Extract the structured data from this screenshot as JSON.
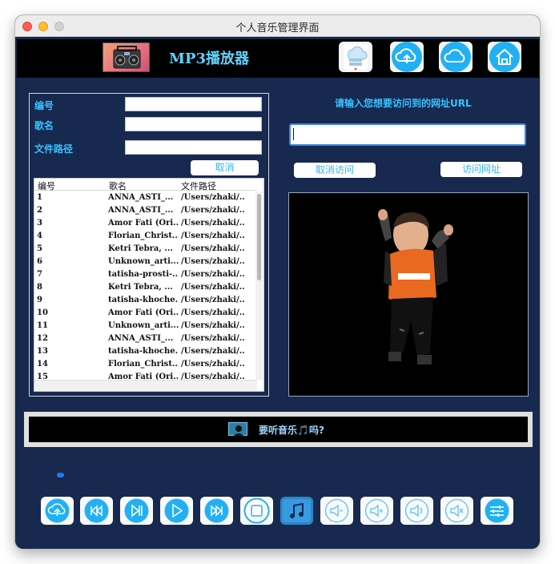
{
  "window": {
    "title": "个人音乐管理界面"
  },
  "header": {
    "app_title": "MP3播放器"
  },
  "form": {
    "id_label": "编号",
    "name_label": "歌名",
    "path_label": "文件路径",
    "id_value": "",
    "name_value": "",
    "path_value": "",
    "cancel_label": "取消"
  },
  "table": {
    "columns": [
      "编号",
      "歌名",
      "文件路径"
    ],
    "rows": [
      [
        "1",
        "ANNA_ASTI_...",
        "/Users/zhaki/..."
      ],
      [
        "2",
        "ANNA_ASTI_...",
        "/Users/zhaki/..."
      ],
      [
        "3",
        "Amor Fati (Ori...",
        "/Users/zhaki/..."
      ],
      [
        "4",
        "Florian_Christ...",
        "/Users/zhaki/..."
      ],
      [
        "5",
        "Ketri   Tebra, ...",
        "/Users/zhaki/..."
      ],
      [
        "6",
        "Unknown_arti...",
        "/Users/zhaki/..."
      ],
      [
        "7",
        "tatisha-prosti-...",
        "/Users/zhaki/..."
      ],
      [
        "8",
        "Ketri   Tebra, ...",
        "/Users/zhaki/..."
      ],
      [
        "9",
        "tatisha-khoche...",
        "/Users/zhaki/..."
      ],
      [
        "10",
        "Amor Fati (Ori...",
        "/Users/zhaki/..."
      ],
      [
        "11",
        "Unknown_arti...",
        "/Users/zhaki/..."
      ],
      [
        "12",
        "ANNA_ASTI_...",
        "/Users/zhaki/..."
      ],
      [
        "13",
        "tatisha-khoche...",
        "/Users/zhaki/..."
      ],
      [
        "14",
        "Florian_Christ...",
        "/Users/zhaki/..."
      ],
      [
        "15",
        "Amor Fati (Ori...",
        "/Users/zhaki/..."
      ]
    ]
  },
  "browser": {
    "prompt": "请输入您想要访问到的网址URL",
    "url_value": "",
    "cancel_visit_label": "取消访问",
    "visit_label": "访问网址"
  },
  "banner": {
    "text": "要听音乐🎵吗?"
  },
  "icons": {
    "header": [
      "cloud-server-icon",
      "cloud-upload-icon",
      "cloud-icon",
      "home-icon"
    ],
    "controls": [
      "upload-icon",
      "fast-rewind-icon",
      "play-pause-icon",
      "play-icon",
      "fast-forward-icon",
      "stop-icon",
      "music-library-icon",
      "volume-mute-icon",
      "volume-down-icon",
      "volume-up-icon",
      "volume-off-icon",
      "equalizer-icon"
    ]
  },
  "colors": {
    "background": "#18294f",
    "accent": "#36c2ff",
    "icon_blue": "#22b0f4",
    "progress": "#1e7bf2"
  }
}
